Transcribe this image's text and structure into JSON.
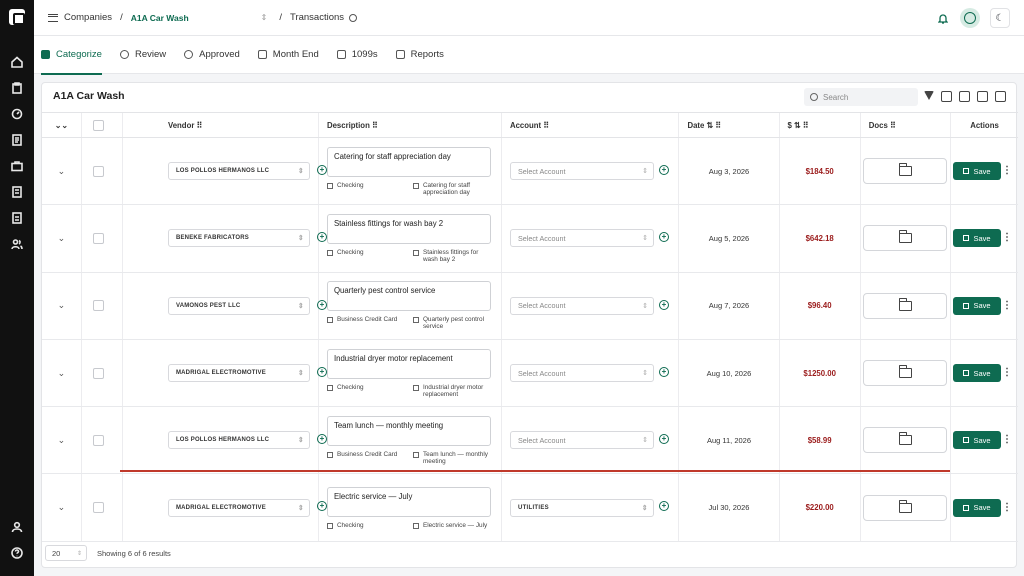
{
  "sidebar": {
    "icons": [
      "logo-icon",
      "home-icon",
      "clipboard-icon",
      "gauge-icon",
      "document-icon",
      "briefcase-icon",
      "ledger-icon",
      "report-icon",
      "users-icon",
      "user-icon",
      "help-icon"
    ]
  },
  "breadcrumb": {
    "companies": "Companies",
    "company": "A1A Car Wash",
    "transactions": "Transactions"
  },
  "tabs": [
    "Categorize",
    "Review",
    "Approved",
    "Month End",
    "1099s",
    "Reports"
  ],
  "card": {
    "title": "A1A Car Wash",
    "search_placeholder": "Search"
  },
  "columns": {
    "vendor": "Vendor ⠿",
    "description": "Description ⠿",
    "account": "Account ⠿",
    "date": "Date ⇅ ⠿",
    "amount": "$ ⇅ ⠿",
    "docs": "Docs ⠿",
    "actions": "Actions"
  },
  "rows": [
    {
      "vendor": "LOS POLLOS HERMANOS LLC",
      "description": "Catering for staff appreciation day",
      "account_type": "Checking",
      "note": "Catering for staff appreciation day",
      "account": "Select Account",
      "date": "Aug 3, 2026",
      "amount": "$184.50",
      "save": "Save"
    },
    {
      "vendor": "BENEKE FABRICATORS",
      "description": "Stainless fittings for wash bay 2",
      "account_type": "Checking",
      "note": "Stainless fittings for wash bay 2",
      "account": "Select Account",
      "date": "Aug 5, 2026",
      "amount": "$642.18",
      "save": "Save"
    },
    {
      "vendor": "VAMONOS PEST LLC",
      "description": "Quarterly pest control service",
      "account_type": "Business Credit Card",
      "note": "Quarterly pest control service",
      "account": "Select Account",
      "date": "Aug 7, 2026",
      "amount": "$96.40",
      "save": "Save"
    },
    {
      "vendor": "MADRIGAL ELECTROMOTIVE",
      "description": "Industrial dryer motor replacement",
      "account_type": "Checking",
      "note": "Industrial dryer motor replacement",
      "account": "Select Account",
      "date": "Aug 10, 2026",
      "amount": "$1250.00",
      "save": "Save"
    },
    {
      "vendor": "LOS POLLOS HERMANOS LLC",
      "description": "Team lunch — monthly meeting",
      "account_type": "Business Credit Card",
      "note": "Team lunch — monthly meeting",
      "account": "Select Account",
      "date": "Aug 11, 2026",
      "amount": "$58.99",
      "save": "Save"
    },
    {
      "vendor": "MADRIGAL ELECTROMOTIVE",
      "description": "Electric service — July",
      "account_type": "Checking",
      "note": "Electric service — July",
      "account": "UTILITIES",
      "date": "Jul 30, 2026",
      "amount": "$220.00",
      "save": "Save"
    }
  ],
  "footer": {
    "page_size": "20",
    "results": "Showing 6 of 6 results"
  },
  "colors": {
    "brand": "#0e6b51",
    "amount": "#9b1c1c",
    "divider": "#c0392b"
  }
}
